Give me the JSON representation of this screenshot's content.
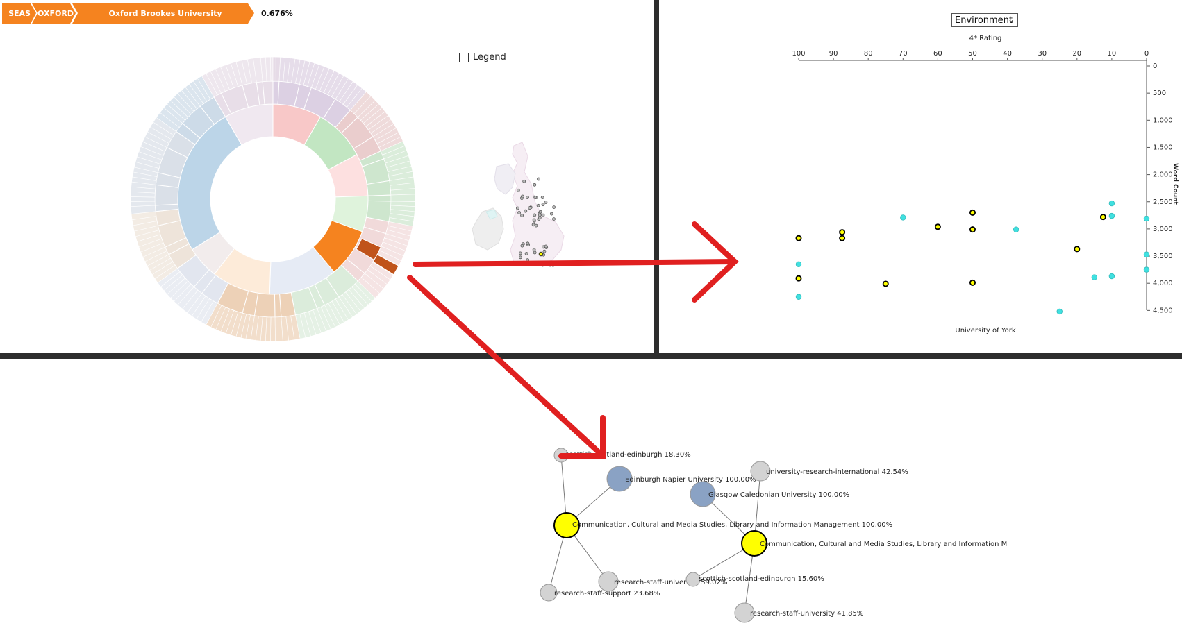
{
  "breadcrumb": {
    "items": [
      "SEAS",
      "OXFORD",
      "Oxford Brookes University"
    ],
    "percentage": "0.676%",
    "colors": {
      "crumb": "#f5831f",
      "text": "#ffffff"
    }
  },
  "legend": {
    "label": "Legend",
    "checked": false
  },
  "environment_select": {
    "value": "Environment"
  },
  "sunburst": {
    "highlight_color": "#f5831f",
    "dark_highlight_color": "#c0531a"
  },
  "scatter": {
    "top_axis_label": "4* Rating",
    "right_axis_label": "Word Count",
    "bottom_label": "University of York",
    "x_ticks": [
      "100",
      "90",
      "80",
      "70",
      "60",
      "50",
      "40",
      "30",
      "20",
      "10",
      "0"
    ],
    "y_ticks": [
      "0",
      "500",
      "1,000",
      "1,500",
      "2,000",
      "2,500",
      "3,000",
      "3,500",
      "4,000",
      "4,500"
    ],
    "colors": {
      "yellow": "#ffff00",
      "cyan": "#40e0e0"
    }
  },
  "chart_data": {
    "type": "scatter",
    "title": "",
    "xlabel": "4* Rating",
    "ylabel": "Word Count",
    "xlim": [
      100,
      0
    ],
    "ylim": [
      0,
      4500
    ],
    "series": [
      {
        "values": [
          [
            100,
            3170
          ],
          [
            100,
            3910
          ],
          [
            87.5,
            3060
          ],
          [
            87.5,
            3170
          ],
          [
            75,
            4010
          ],
          [
            60,
            2960
          ],
          [
            50,
            2700
          ],
          [
            50,
            3010
          ],
          [
            50,
            3990
          ],
          [
            20,
            3370
          ],
          [
            12.5,
            2780
          ]
        ]
      },
      {
        "values": [
          [
            100,
            3650
          ],
          [
            100,
            4250
          ],
          [
            70,
            2790
          ],
          [
            37.5,
            3010
          ],
          [
            25,
            4520
          ],
          [
            15,
            3890
          ],
          [
            10,
            2530
          ],
          [
            10,
            2760
          ],
          [
            10,
            3870
          ],
          [
            0,
            2810
          ],
          [
            0,
            3470
          ],
          [
            0,
            3750
          ]
        ]
      }
    ]
  },
  "network": {
    "nodes": [
      {
        "id": "sse1",
        "label": "scottish-scotland-edinburgh 18.30%"
      },
      {
        "id": "enu",
        "label": "Edinburgh Napier University 100.00%"
      },
      {
        "id": "ccms1",
        "label": "Communication, Cultural and Media Studies, Library and Information Management 100.00%"
      },
      {
        "id": "rss",
        "label": "research-staff-support 23.68%"
      },
      {
        "id": "rsu1",
        "label": "research-staff-university 59.02%"
      },
      {
        "id": "uri",
        "label": "university-research-international 42.54%"
      },
      {
        "id": "gcu",
        "label": "Glasgow Caledonian University 100.00%"
      },
      {
        "id": "ccms2",
        "label": "Communication, Cultural and Media Studies, Library and Information M"
      },
      {
        "id": "sse2",
        "label": "scottish-scotland-edinburgh 15.60%"
      },
      {
        "id": "rsu2",
        "label": "research-staff-university 41.85%"
      }
    ],
    "colors": {
      "yellow": "#ffff00",
      "blue": "#8aa2c4",
      "grey": "#d3d3d3"
    }
  },
  "annotation_arrows": {
    "color": "#e02020"
  }
}
